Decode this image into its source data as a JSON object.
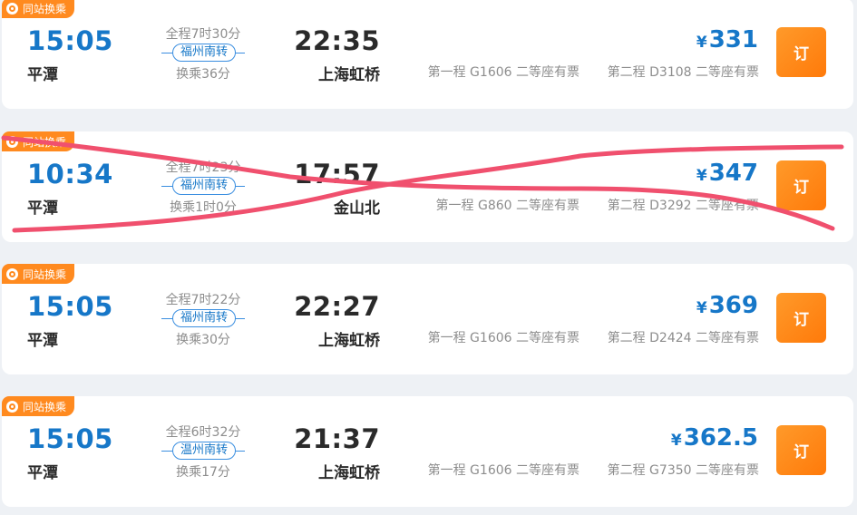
{
  "results": [
    {
      "badge": "同站换乘",
      "dep_time": "15:05",
      "dep_station": "平潭",
      "duration": "全程7时30分",
      "transfer": "福州南转",
      "wait": "换乘36分",
      "arr_time": "22:35",
      "arr_station": "上海虹桥",
      "currency": "¥",
      "price": "331",
      "leg1": "第一程 G1606 二等座有票",
      "leg2": "第二程 D3108 二等座有票",
      "book_label": "订"
    },
    {
      "badge": "同站换乘",
      "dep_time": "10:34",
      "dep_station": "平潭",
      "duration": "全程7时23分",
      "transfer": "福州南转",
      "wait": "换乘1时0分",
      "arr_time": "17:57",
      "arr_station": "金山北",
      "currency": "¥",
      "price": "347",
      "leg1": "第一程 G860 二等座有票",
      "leg2": "第二程 D3292 二等座有票",
      "book_label": "订"
    },
    {
      "badge": "同站换乘",
      "dep_time": "15:05",
      "dep_station": "平潭",
      "duration": "全程7时22分",
      "transfer": "福州南转",
      "wait": "换乘30分",
      "arr_time": "22:27",
      "arr_station": "上海虹桥",
      "currency": "¥",
      "price": "369",
      "leg1": "第一程 G1606 二等座有票",
      "leg2": "第二程 D2424 二等座有票",
      "book_label": "订"
    },
    {
      "badge": "同站换乘",
      "dep_time": "15:05",
      "dep_station": "平潭",
      "duration": "全程6时32分",
      "transfer": "温州南转",
      "wait": "换乘17分",
      "arr_time": "21:37",
      "arr_station": "上海虹桥",
      "currency": "¥",
      "price": "362.5",
      "leg1": "第一程 G1606 二等座有票",
      "leg2": "第二程 G7350 二等座有票",
      "book_label": "订"
    }
  ],
  "colors": {
    "accent_blue": "#1677c8",
    "orange": "#ff8a1f",
    "strike": "#f0506e"
  }
}
